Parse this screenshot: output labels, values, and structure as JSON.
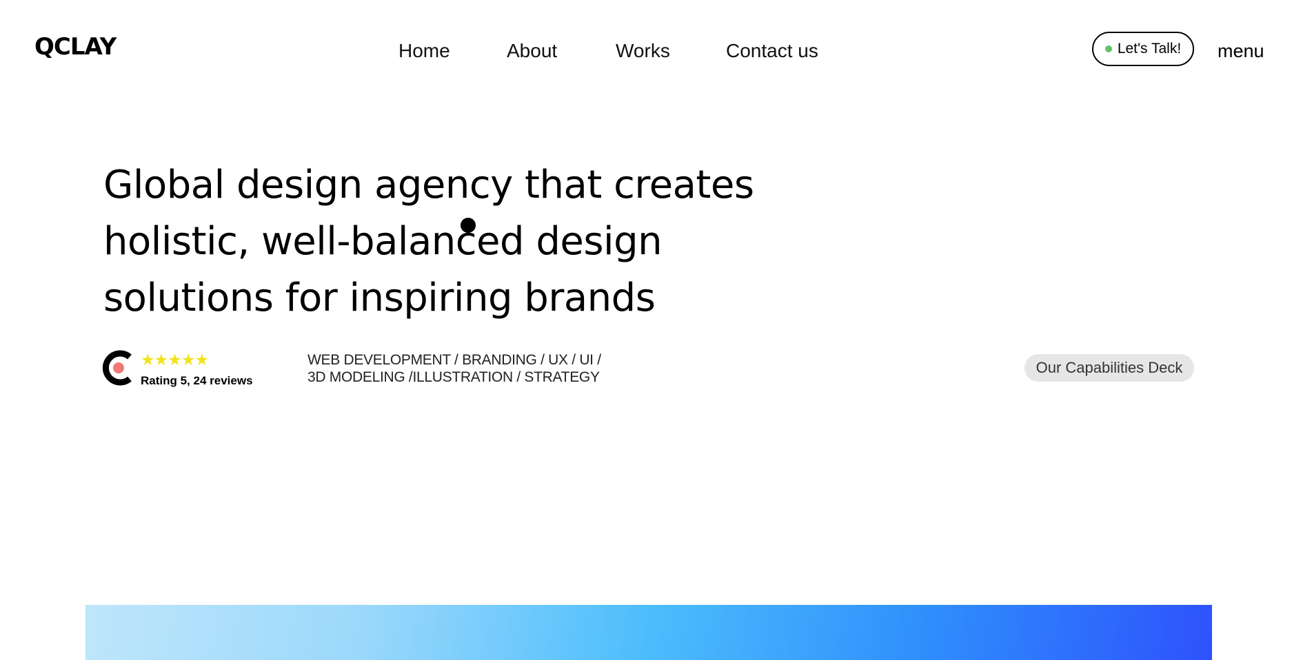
{
  "header": {
    "logo_text": "QCLAY",
    "nav": [
      {
        "label": "Home"
      },
      {
        "label": "About"
      },
      {
        "label": "Works"
      },
      {
        "label": "Contact us"
      }
    ],
    "talk_button": {
      "label": "Let's Talk!",
      "status_dot_color": "#5fc26b"
    },
    "menu_label": "menu"
  },
  "hero": {
    "headline_lines": [
      "Global design agency that creates",
      "holistic, well-balanced design",
      "solutions for inspiring brands"
    ]
  },
  "rating": {
    "stars": "★★★★★",
    "stars_value": 5,
    "star_color": "#f2e31a",
    "text": "Rating 5, 24 reviews",
    "badge_icon": "clutch-logo-icon",
    "badge_accent": "#f17a74"
  },
  "services": {
    "lines": [
      "WEB DEVELOPMENT / BRANDING / UX / UI /",
      "3D MODELING /ILLUSTRATION / STRATEGY"
    ]
  },
  "capabilities_button": {
    "label": "Our Capabilities Deck",
    "bg_color": "#e6e6e6"
  },
  "banner": {
    "gradient_colors": [
      "#bfe6fb",
      "#9ad8fb",
      "#4cbdfc",
      "#2f8dfc",
      "#2e52fc"
    ]
  }
}
